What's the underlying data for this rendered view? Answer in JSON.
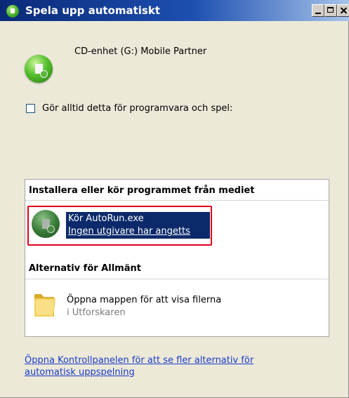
{
  "window": {
    "title": "Spela upp automatiskt",
    "controls": [
      "minimize",
      "maximize",
      "close"
    ]
  },
  "device": {
    "label": "CD-enhet (G:) Mobile Partner",
    "icon": "autoplay-disc-icon"
  },
  "always_option": {
    "label": "Gör alltid detta för programvara och spel:",
    "checked": false
  },
  "install_section": {
    "heading": "Installera eller kör programmet från mediet",
    "item": {
      "title": "Kör AutoRun.exe",
      "subtitle": "Ingen utgivare har angetts",
      "selected": true,
      "highlight_color": "#e0001b"
    }
  },
  "general_section": {
    "heading": "Alternativ för Allmänt",
    "item": {
      "title": "Öppna mappen för att visa filerna",
      "subtitle": "i Utforskaren",
      "icon": "folder-icon"
    }
  },
  "footer_link": {
    "line1": "Öppna Kontrollpanelen för att se fler alternativ för",
    "line2": "automatisk uppspelning"
  },
  "colors": {
    "titlebar": "#0a2a78",
    "selection": "#0c2a6a",
    "link": "#1a3cc8"
  }
}
